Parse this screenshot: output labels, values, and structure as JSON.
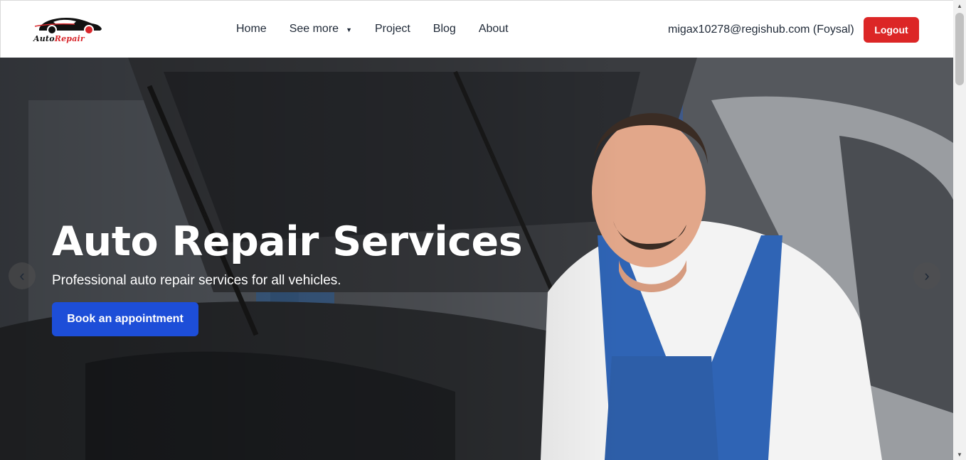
{
  "brand": {
    "logo_text_part1": "Auto",
    "logo_text_part2": "Repair",
    "accent": "#d8262b"
  },
  "nav": {
    "items": [
      {
        "label": "Home"
      },
      {
        "label": "See more",
        "has_dropdown": true
      },
      {
        "label": "Project"
      },
      {
        "label": "Blog"
      },
      {
        "label": "About"
      }
    ]
  },
  "user": {
    "display": "migax10278@regishub.com (Foysal)",
    "logout_label": "Logout"
  },
  "hero": {
    "title": "Auto Repair Services",
    "subtitle": "Professional auto repair services for all vehicles.",
    "cta_label": "Book an appointment",
    "prev_icon": "chevron-left-icon",
    "next_icon": "chevron-right-icon"
  },
  "colors": {
    "primary": "#1d4ed8",
    "danger": "#dc2626",
    "text": "#1f2937"
  }
}
